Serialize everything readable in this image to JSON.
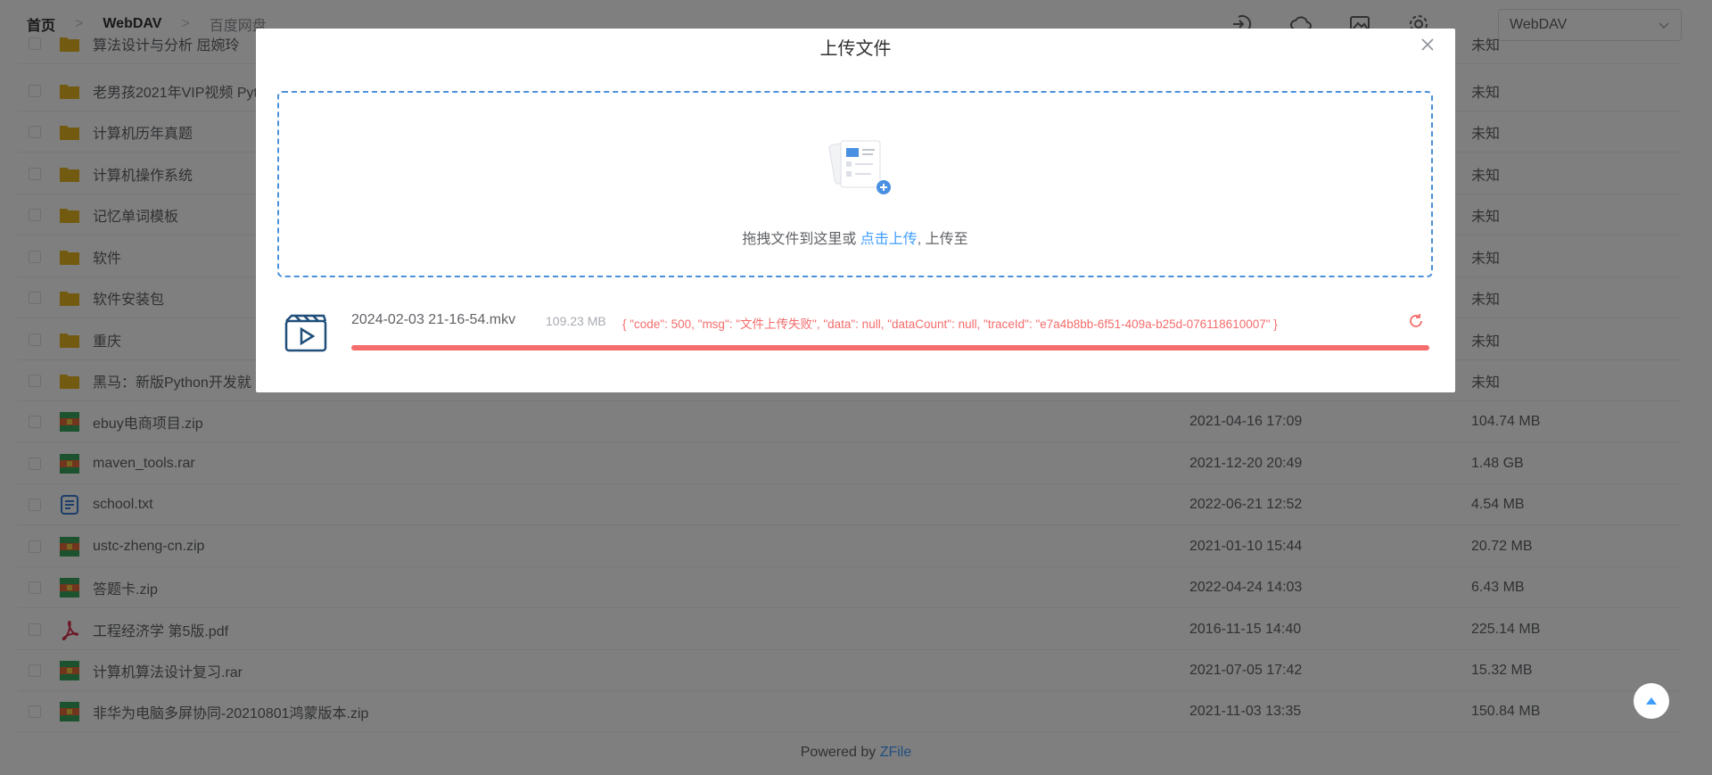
{
  "breadcrumb": {
    "items": [
      "首页",
      "WebDAV",
      "百度网盘"
    ]
  },
  "storage_select": {
    "value": "WebDAV"
  },
  "icons": [
    "login-icon",
    "cloud-icon",
    "gallery-icon",
    "gear-icon",
    "chevron-down-icon"
  ],
  "files": [
    {
      "name": "算法设计与分析 屈婉玲",
      "date": "",
      "size": "未知",
      "type": "folder"
    },
    {
      "name": "老男孩2021年VIP视频 Pyt",
      "date": "",
      "size": "未知",
      "type": "folder"
    },
    {
      "name": "计算机历年真题",
      "date": "",
      "size": "未知",
      "type": "folder"
    },
    {
      "name": "计算机操作系统",
      "date": "",
      "size": "未知",
      "type": "folder"
    },
    {
      "name": "记忆单词模板",
      "date": "",
      "size": "未知",
      "type": "folder"
    },
    {
      "name": "软件",
      "date": "",
      "size": "未知",
      "type": "folder"
    },
    {
      "name": "软件安装包",
      "date": "",
      "size": "未知",
      "type": "folder"
    },
    {
      "name": "重庆",
      "date": "",
      "size": "未知",
      "type": "folder"
    },
    {
      "name": "黑马：新版Python开发就",
      "date": "",
      "size": "未知",
      "type": "folder"
    },
    {
      "name": "ebuy电商项目.zip",
      "date": "2021-04-16 17:09",
      "size": "104.74 MB",
      "type": "archive"
    },
    {
      "name": "maven_tools.rar",
      "date": "2021-12-20 20:49",
      "size": "1.48 GB",
      "type": "archive"
    },
    {
      "name": "school.txt",
      "date": "2022-06-21 12:52",
      "size": "4.54 MB",
      "type": "text"
    },
    {
      "name": "ustc-zheng-cn.zip",
      "date": "2021-01-10 15:44",
      "size": "20.72 MB",
      "type": "archive"
    },
    {
      "name": "答题卡.zip",
      "date": "2022-04-24 14:03",
      "size": "6.43 MB",
      "type": "archive"
    },
    {
      "name": "工程经济学 第5版.pdf",
      "date": "2016-11-15 14:40",
      "size": "225.14 MB",
      "type": "pdf"
    },
    {
      "name": "计算机算法设计复习.rar",
      "date": "2021-07-05 17:42",
      "size": "15.32 MB",
      "type": "archive"
    },
    {
      "name": "非华为电脑多屏协同-20210801鸿蒙版本.zip",
      "date": "2021-11-03 13:35",
      "size": "150.84 MB",
      "type": "archive"
    }
  ],
  "footer": {
    "prefix": "Powered by ",
    "brand": "ZFile"
  },
  "dialog": {
    "title": "上传文件",
    "drop_text_before": "拖拽文件到这里或 ",
    "drop_link": "点击上传",
    "drop_text_after": ", 上传至",
    "upload": {
      "filename": "2024-02-03 21-16-54.mkv",
      "size": "109.23 MB",
      "error": "{ \"code\": 500, \"msg\": \"文件上传失败\", \"data\": null, \"dataCount\": null, \"traceId\": \"e7a4b8bb-6f51-409a-b25d-076118610007\" }",
      "progress_percent": 100,
      "status_color": "#f56c6c"
    }
  },
  "colors": {
    "accent": "#409eff",
    "error": "#f56c6c",
    "folder": "#e6b422"
  }
}
